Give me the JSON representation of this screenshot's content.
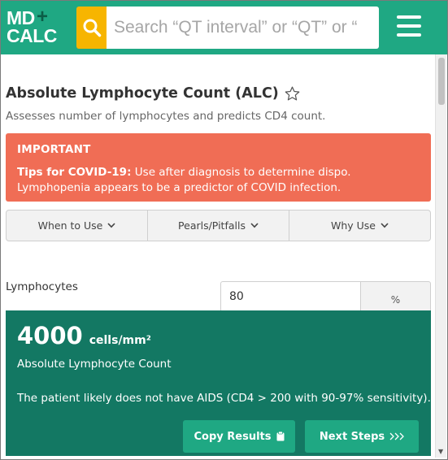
{
  "header": {
    "logo_line1": "MD",
    "logo_plus": "+",
    "logo_line2": "CALC",
    "search_placeholder": "Search “QT interval” or “QT” or “",
    "search_icon": "search-icon",
    "menu_icon": "hamburger-menu-icon",
    "accent_color": "#1fa883",
    "search_color": "#f7b500"
  },
  "calculator": {
    "title": "Absolute Lymphocyte Count (ALC)",
    "subtitle": "Assesses number of lymphocytes and predicts CD4 count.",
    "favorite_icon": "star-outline-icon"
  },
  "important": {
    "heading": "IMPORTANT",
    "tip_label": "Tips for COVID-19:",
    "tip_text": " Use after diagnosis to determine dispo. Lymphopenia appears to be a predictor of COVID infection.",
    "color": "#f06d55"
  },
  "tabs": [
    {
      "label": "When to Use"
    },
    {
      "label": "Pearls/Pitfalls"
    },
    {
      "label": "Why Use"
    }
  ],
  "inputs": {
    "lymphocytes": {
      "label": "Lymphocytes",
      "value": "80",
      "unit": "%"
    }
  },
  "result": {
    "value": "4000",
    "unit": "cells/mm²",
    "name": "Absolute Lymphocyte Count",
    "interpretation": "The patient likely does not have AIDS (CD4 > 200 with 90-97% sensitivity).",
    "copy_label": "Copy Results",
    "next_label": "Next Steps",
    "color": "#137863"
  }
}
